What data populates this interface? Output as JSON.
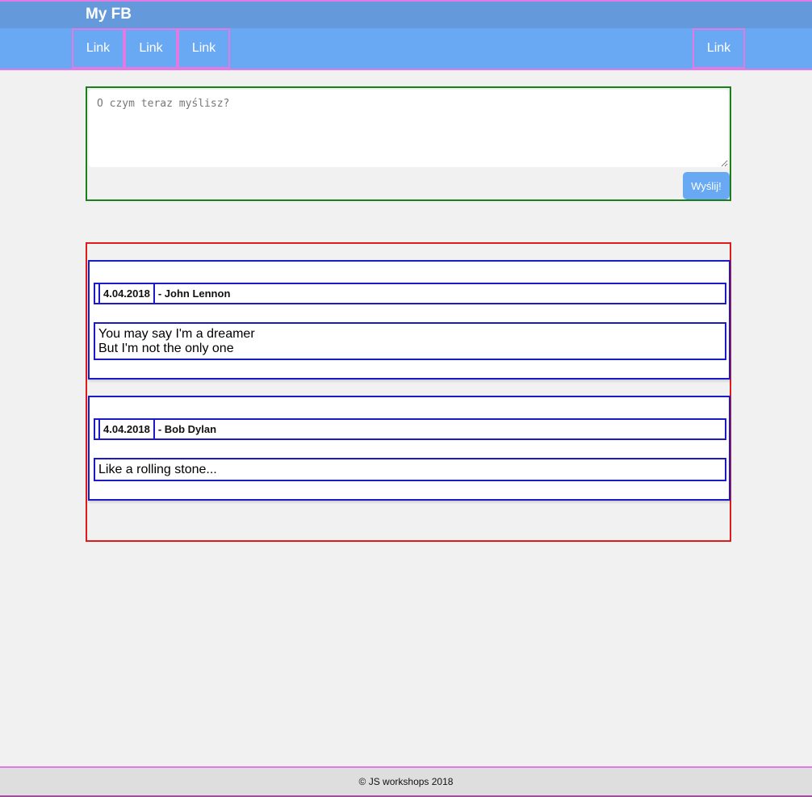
{
  "header": {
    "brand": "My FB",
    "nav": [
      {
        "label": "Link"
      },
      {
        "label": "Link"
      },
      {
        "label": "Link"
      }
    ],
    "nav_right": {
      "label": "Link"
    }
  },
  "composer": {
    "placeholder": "O czym teraz myślisz?",
    "value": "",
    "submit_label": "Wyślij!"
  },
  "posts": [
    {
      "date": "4.04.2018",
      "author": "- John Lennon",
      "lines": [
        "You may say I'm a dreamer",
        "But I'm not the only one"
      ]
    },
    {
      "date": "4.04.2018",
      "author": "- Bob Dylan",
      "lines": [
        "Like a rolling stone..."
      ]
    }
  ],
  "footer": {
    "text": "© JS workshops 2018"
  },
  "colors": {
    "header_bg": "#69a8f2",
    "brand_bar_bg": "#6499db",
    "outline_pink": "#e27ae6",
    "composer_border": "#1b7f1b",
    "posts_border": "#e01b1b",
    "post_border": "#1a1acc",
    "page_bg": "#f1f1f1",
    "footer_bg": "#dedede"
  }
}
